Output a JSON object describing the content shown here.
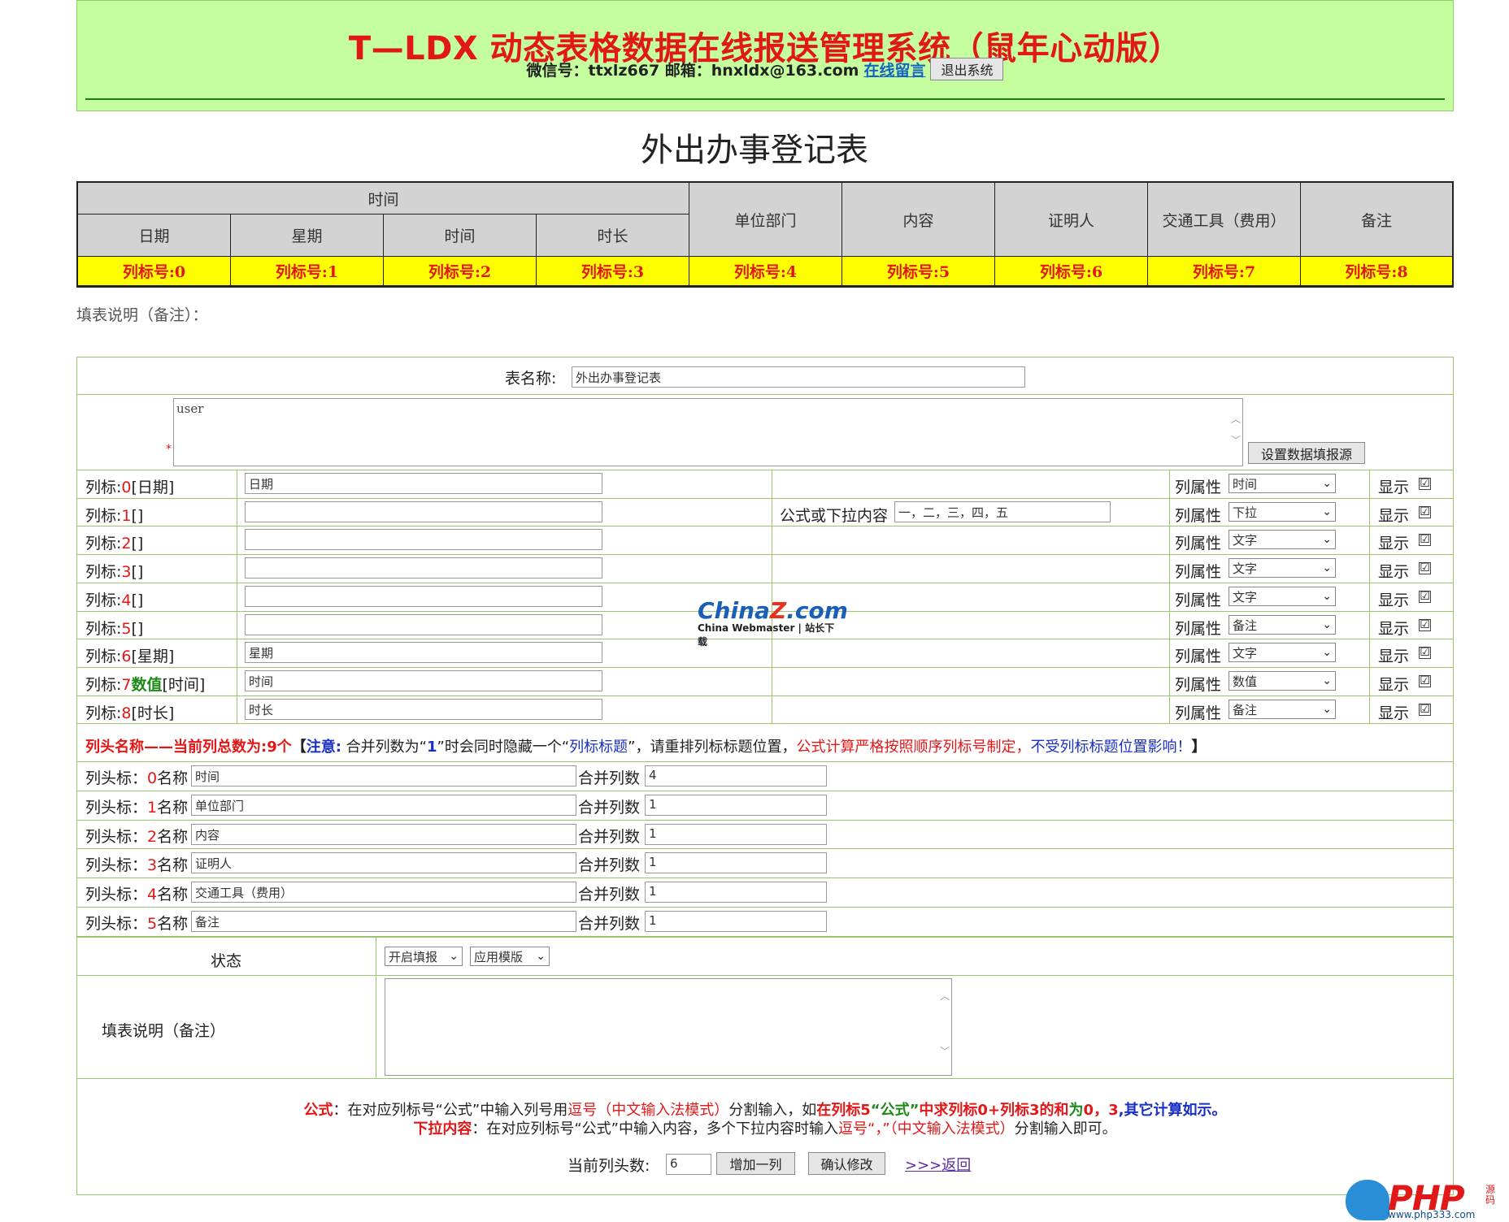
{
  "header": {
    "title": "T—LDX 动态表格数据在线报送管理系统（鼠年心动版）",
    "contact": "微信号：ttxlz667 邮箱：hnxldx@163.com",
    "message_link": "在线留言",
    "logout_button": "退出系统",
    "bg_color": "#c4fe9e",
    "title_color": "#e21717"
  },
  "form_title": "外出办事登记表",
  "preview": {
    "group_header": "时间",
    "sub_headers": [
      "日期",
      "星期",
      "时间",
      "时长"
    ],
    "headers": [
      "单位部门",
      "内容",
      "证明人",
      "交通工具（费用）",
      "备注"
    ],
    "col_labels": [
      "列标号:0",
      "列标号:1",
      "列标号:2",
      "列标号:3",
      "列标号:4",
      "列标号:5",
      "列标号:6",
      "列标号:7",
      "列标号:8"
    ]
  },
  "note_label": "填表说明（备注）：",
  "editor": {
    "table_name_label": "表名称:",
    "table_name_value": "外出办事登记表",
    "source_textarea_value": "user",
    "required_mark": "*",
    "set_source_button": "设置数据填报源",
    "attr_label": "列属性",
    "show_label": "显示",
    "formula_label": "公式或下拉内容",
    "columns": [
      {
        "prefix": "列标:",
        "num": "0",
        "bracket": "[日期]",
        "value": "日期",
        "formula": "",
        "attr": "时间",
        "show": "☑"
      },
      {
        "prefix": "列标:",
        "num": "1",
        "bracket": "[]",
        "value": "",
        "formula": "一，二，三，四，五",
        "attr": "下拉",
        "show": "☑"
      },
      {
        "prefix": "列标:",
        "num": "2",
        "bracket": "[]",
        "value": "",
        "formula": "",
        "attr": "文字",
        "show": "☑"
      },
      {
        "prefix": "列标:",
        "num": "3",
        "bracket": "[]",
        "value": "",
        "formula": "",
        "attr": "文字",
        "show": "☑"
      },
      {
        "prefix": "列标:",
        "num": "4",
        "bracket": "[]",
        "value": "",
        "formula": "",
        "attr": "文字",
        "show": "☑"
      },
      {
        "prefix": "列标:",
        "num": "5",
        "bracket": "[]",
        "value": "",
        "formula": "",
        "attr": "备注",
        "show": "☑"
      },
      {
        "prefix": "列标:",
        "num": "6",
        "bracket": "[星期]",
        "value": "星期",
        "formula": "",
        "attr": "文字",
        "show": "☑"
      },
      {
        "prefix": "列标:",
        "num": "7",
        "bracket": "[时间]",
        "value": "时间",
        "formula": "",
        "attr": "数值",
        "show": "☑",
        "flag": "数值"
      },
      {
        "prefix": "列标:",
        "num": "8",
        "bracket": "[时长]",
        "value": "时长",
        "formula": "",
        "attr": "备注",
        "show": "☑"
      }
    ],
    "head_notice": {
      "a": "列头名称——当前列总数为:9个",
      "b": "【",
      "c": "注意:",
      "d": " 合并列数为“",
      "e": "1",
      "f": "”时会同时隐藏一个“",
      "g": "列标标题",
      "h": "”，请重排列标标题位置，",
      "i": "公式计算严格按照顺序列标号制定，",
      "j": "不受列标标题位置影响！",
      "k": "】"
    },
    "head_prefix": "列头标：",
    "head_name_label": "名称",
    "merge_label": "合并列数",
    "heads": [
      {
        "num": "0",
        "name": "时间",
        "merge": "4"
      },
      {
        "num": "1",
        "name": "单位部门",
        "merge": "1"
      },
      {
        "num": "2",
        "name": "内容",
        "merge": "1"
      },
      {
        "num": "3",
        "name": "证明人",
        "merge": "1"
      },
      {
        "num": "4",
        "name": "交通工具（费用）",
        "merge": "1"
      },
      {
        "num": "5",
        "name": "备注",
        "merge": "1"
      }
    ],
    "status_label": "状态",
    "status_select": "开启填报",
    "template_select": "应用模版",
    "fill_note_label": "填表说明（备注）",
    "help": {
      "f1": "公式",
      "f2": "：在对应列标号“公式”中输入列号用",
      "f3": "逗号（中文输入法模式）",
      "f4": "分割输入，如",
      "f5": "在列标5",
      "f6": "“公式”",
      "f7": "中求",
      "f8": "列标0+列标3的和",
      "f9": "为",
      "f10": "0，3",
      "f11": ",其它计算如示。",
      "d1": "下拉内容",
      "d2": "：在对应列标号“公式”中输入内容，多个下拉内容时输入",
      "d3": "逗号“，”（中文输入法模式）",
      "d4": "分割输入即可。"
    },
    "current_count_label": "当前列头数:",
    "current_count_value": "6",
    "add_button": "增加一列",
    "confirm_button": "确认修改",
    "back_link": ">>>返回"
  },
  "watermarks": {
    "chinaz_a": "China",
    "chinaz_z": "Z",
    "chinaz_b": ".com",
    "chinaz_sub": "China Webmaster | 站长下载",
    "php": "PHP",
    "php_side": "源码",
    "php_url": "www.php333.com"
  }
}
